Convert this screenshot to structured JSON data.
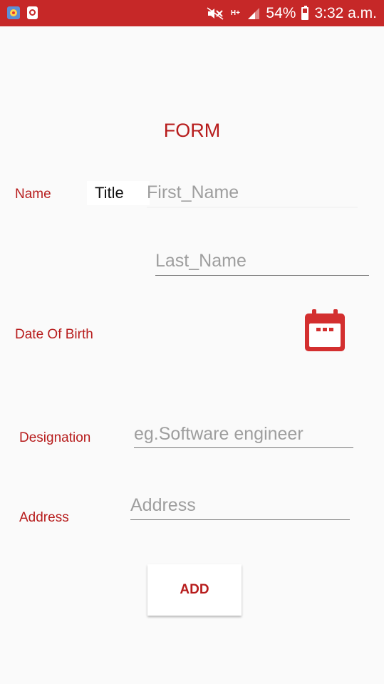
{
  "status_bar": {
    "network_type": "H+",
    "battery": "54%",
    "time": "3:32 a.m.",
    "icons": [
      "app-notification-icon",
      "recycle-notification-icon",
      "mute-icon",
      "signal-icon",
      "battery-icon"
    ]
  },
  "form": {
    "title": "FORM",
    "name_label": "Name",
    "title_spinner_value": "Title",
    "first_name_placeholder": "First_Name",
    "last_name_placeholder": "Last_Name",
    "dob_label": "Date Of Birth",
    "calendar_icon": "calendar-icon",
    "designation_label": "Designation",
    "designation_placeholder": "eg.Software engineer",
    "address_label": "Address",
    "address_placeholder": "Address",
    "add_button": "ADD"
  },
  "colors": {
    "accent": "#c62828",
    "label_text": "#b71c1c",
    "background": "#fafafa",
    "placeholder": "#9e9e9e"
  }
}
